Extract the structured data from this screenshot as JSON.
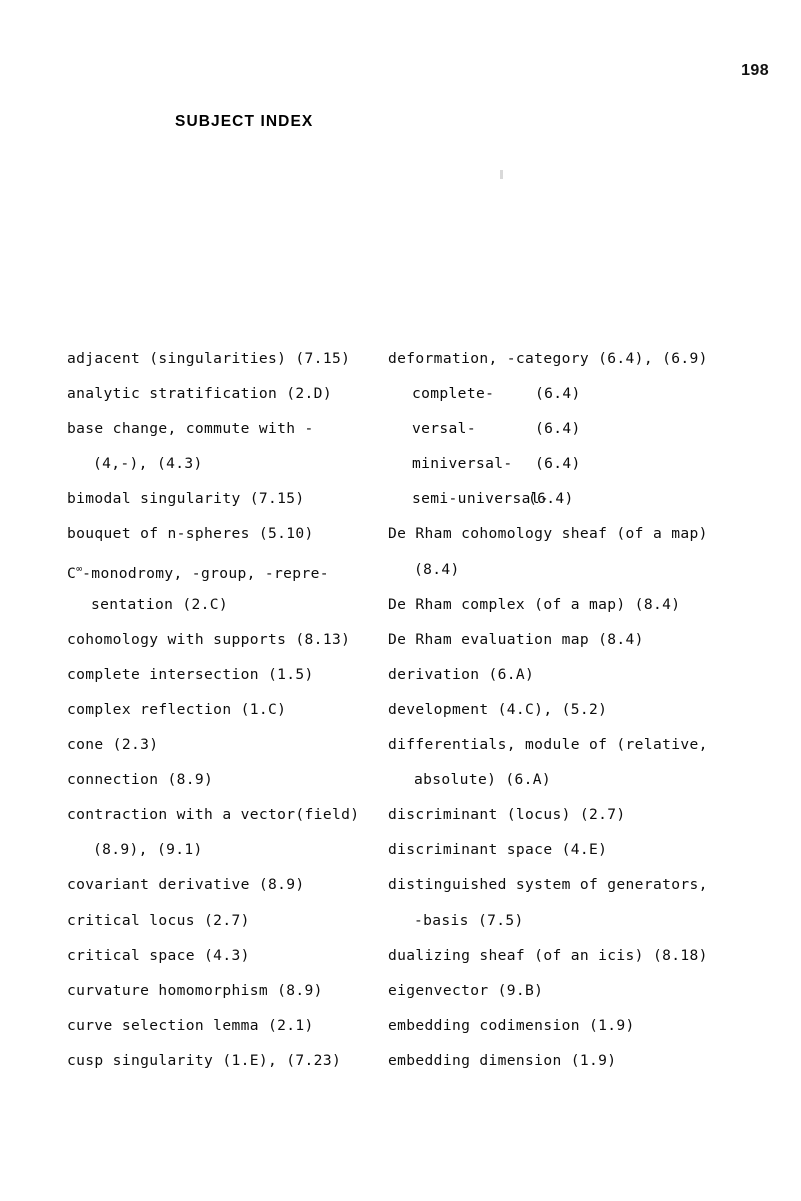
{
  "page": {
    "number": "198",
    "title": "SUBJECT INDEX"
  },
  "index": {
    "left_column": [
      {
        "text": "adjacent (singularities) (7.15)"
      },
      {
        "text": "analytic stratification (2.D)"
      },
      {
        "text": "base change, commute with -"
      },
      {
        "text": "(4,-), (4.3)",
        "indent": 1
      },
      {
        "text": "bimodal singularity (7.15)"
      },
      {
        "text": "bouquet of n-spheres (5.10)"
      },
      {
        "text": "-monodromy, -group, -repre-",
        "prefix": "C",
        "superscript": "∞"
      },
      {
        "text": "sentation (2.C)",
        "indent": 2
      },
      {
        "text": "cohomology with supports (8.13)"
      },
      {
        "text": "complete intersection (1.5)"
      },
      {
        "text": "complex reflection (1.C)"
      },
      {
        "text": "cone (2.3)"
      },
      {
        "text": "connection (8.9)"
      },
      {
        "text": "contraction with a vector(field)"
      },
      {
        "text": "(8.9), (9.1)",
        "indent": 1
      },
      {
        "text": "covariant derivative (8.9)"
      },
      {
        "text": "critical locus (2.7)"
      },
      {
        "text": "critical space (4.3)"
      },
      {
        "text": "curvature homomorphism (8.9)"
      },
      {
        "text": "curve selection lemma (2.1)"
      },
      {
        "text": "cusp singularity (1.E), (7.23)"
      }
    ],
    "right_column": [
      {
        "text": "deformation, -category (6.4), (6.9)"
      },
      {
        "term": "complete-",
        "ref": "(6.4)"
      },
      {
        "term": "versal-",
        "ref": "(6.4)"
      },
      {
        "term": "miniversal-",
        "ref": "(6.4)"
      },
      {
        "term": "semi-universal-",
        "ref": "(6.4)",
        "wide": true
      },
      {
        "text": "De Rham cohomology sheaf (of a map)"
      },
      {
        "text": "(8.4)",
        "indent": 1
      },
      {
        "text": "De Rham complex (of a map) (8.4)"
      },
      {
        "text": "De Rham evaluation map (8.4)"
      },
      {
        "text": "derivation (6.A)"
      },
      {
        "text": "development (4.C), (5.2)"
      },
      {
        "text": "differentials, module of (relative,"
      },
      {
        "text": "absolute) (6.A)",
        "indent": 1
      },
      {
        "text": "discriminant (locus) (2.7)"
      },
      {
        "text": "discriminant space (4.E)"
      },
      {
        "text": "distinguished system of generators,"
      },
      {
        "text": "-basis (7.5)",
        "indent": 1
      },
      {
        "text": "dualizing sheaf (of an icis) (8.18)"
      },
      {
        "text": "eigenvector (9.B)"
      },
      {
        "text": "embedding codimension (1.9)"
      },
      {
        "text": "embedding dimension (1.9)"
      }
    ]
  }
}
